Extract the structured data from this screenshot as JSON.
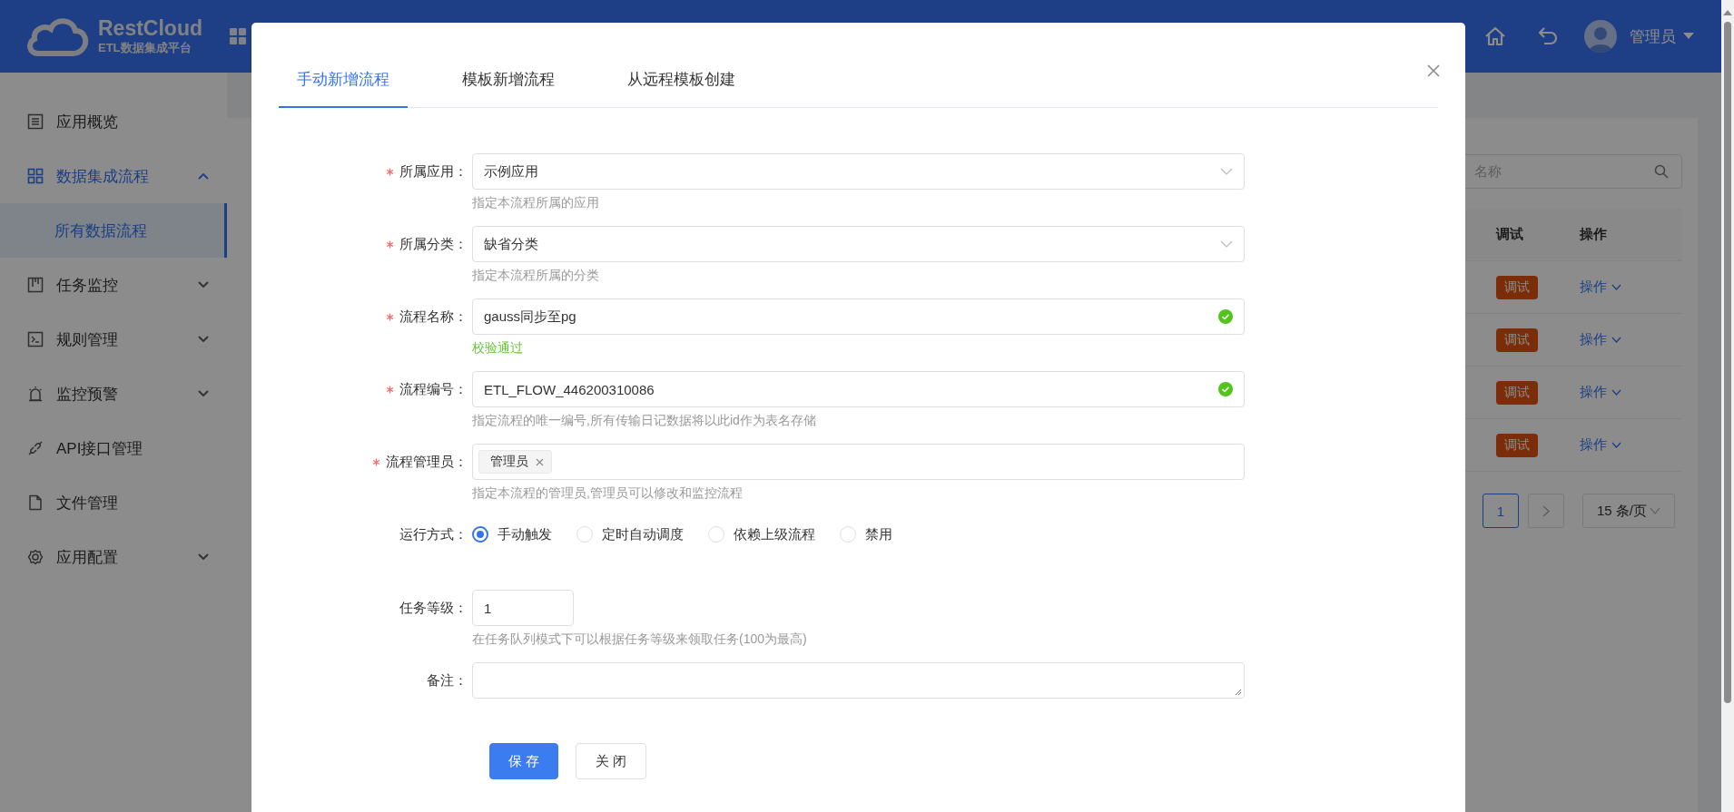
{
  "header": {
    "logo_title": "RestCloud",
    "logo_subtitle": "ETL数据集成平台",
    "user": "管理员"
  },
  "sidebar": {
    "items": [
      {
        "label": "应用概览",
        "kind": "link",
        "active": false
      },
      {
        "label": "数据集成流程",
        "kind": "group",
        "active": true,
        "expanded": true,
        "children": [
          {
            "label": "所有数据流程",
            "selected": true
          }
        ]
      },
      {
        "label": "任务监控",
        "kind": "group",
        "active": false,
        "expanded": false
      },
      {
        "label": "规则管理",
        "kind": "group",
        "active": false,
        "expanded": false
      },
      {
        "label": "监控预警",
        "kind": "group",
        "active": false,
        "expanded": false
      },
      {
        "label": "API接口管理",
        "kind": "link",
        "active": false
      },
      {
        "label": "文件管理",
        "kind": "link",
        "active": false
      },
      {
        "label": "应用配置",
        "kind": "group",
        "active": false,
        "expanded": false
      }
    ]
  },
  "background_list": {
    "search": {
      "placeholder": "名称"
    },
    "columns": [
      "调试",
      "操作"
    ],
    "rows": [
      {
        "debug": "调试",
        "action": "操作"
      },
      {
        "debug": "调试",
        "action": "操作"
      },
      {
        "debug": "调试",
        "action": "操作"
      },
      {
        "debug": "调试",
        "action": "操作"
      }
    ],
    "pagination": {
      "pages": [
        {
          "label": "1",
          "selected": true
        }
      ],
      "page_size": "15 条/页"
    }
  },
  "modal": {
    "tabs": [
      {
        "label": "手动新增流程",
        "selected": true
      },
      {
        "label": "模板新增流程",
        "selected": false
      },
      {
        "label": "从远程模板创建",
        "selected": false
      }
    ],
    "fields": [
      {
        "kind": "select",
        "label": "所属应用：",
        "required": true,
        "value": "示例应用",
        "hint": "指定本流程所属的应用"
      },
      {
        "kind": "select",
        "label": "所属分类：",
        "required": true,
        "value": "缺省分类",
        "hint": "指定本流程所属的分类"
      },
      {
        "kind": "text",
        "label": "流程名称：",
        "required": true,
        "value": "gauss同步至pg",
        "valid": true,
        "message": "校验通过"
      },
      {
        "kind": "text",
        "label": "流程编号：",
        "required": true,
        "value": "ETL_FLOW_446200310086",
        "valid": true,
        "hint": "指定流程的唯一编号,所有传输日记数据将以此id作为表名存储"
      },
      {
        "kind": "tags",
        "label": "流程管理员：",
        "required": true,
        "tags": [
          "管理员"
        ],
        "hint": "指定本流程的管理员,管理员可以修改和监控流程"
      },
      {
        "kind": "radio",
        "label": "运行方式：",
        "required": false,
        "options": [
          {
            "label": "手动触发",
            "selected": true
          },
          {
            "label": "定时自动调度",
            "selected": false
          },
          {
            "label": "依赖上级流程",
            "selected": false
          },
          {
            "label": "禁用",
            "selected": false
          }
        ]
      },
      {
        "kind": "number",
        "label": "任务等级：",
        "required": false,
        "value": "1",
        "hint": "在任务队列模式下可以根据任务等级来领取任务(100为最高)"
      },
      {
        "kind": "textarea",
        "label": "备注：",
        "required": false
      }
    ],
    "buttons": [
      {
        "label": "保存",
        "kind": "primary"
      },
      {
        "label": "关闭",
        "kind": "default"
      }
    ]
  }
}
